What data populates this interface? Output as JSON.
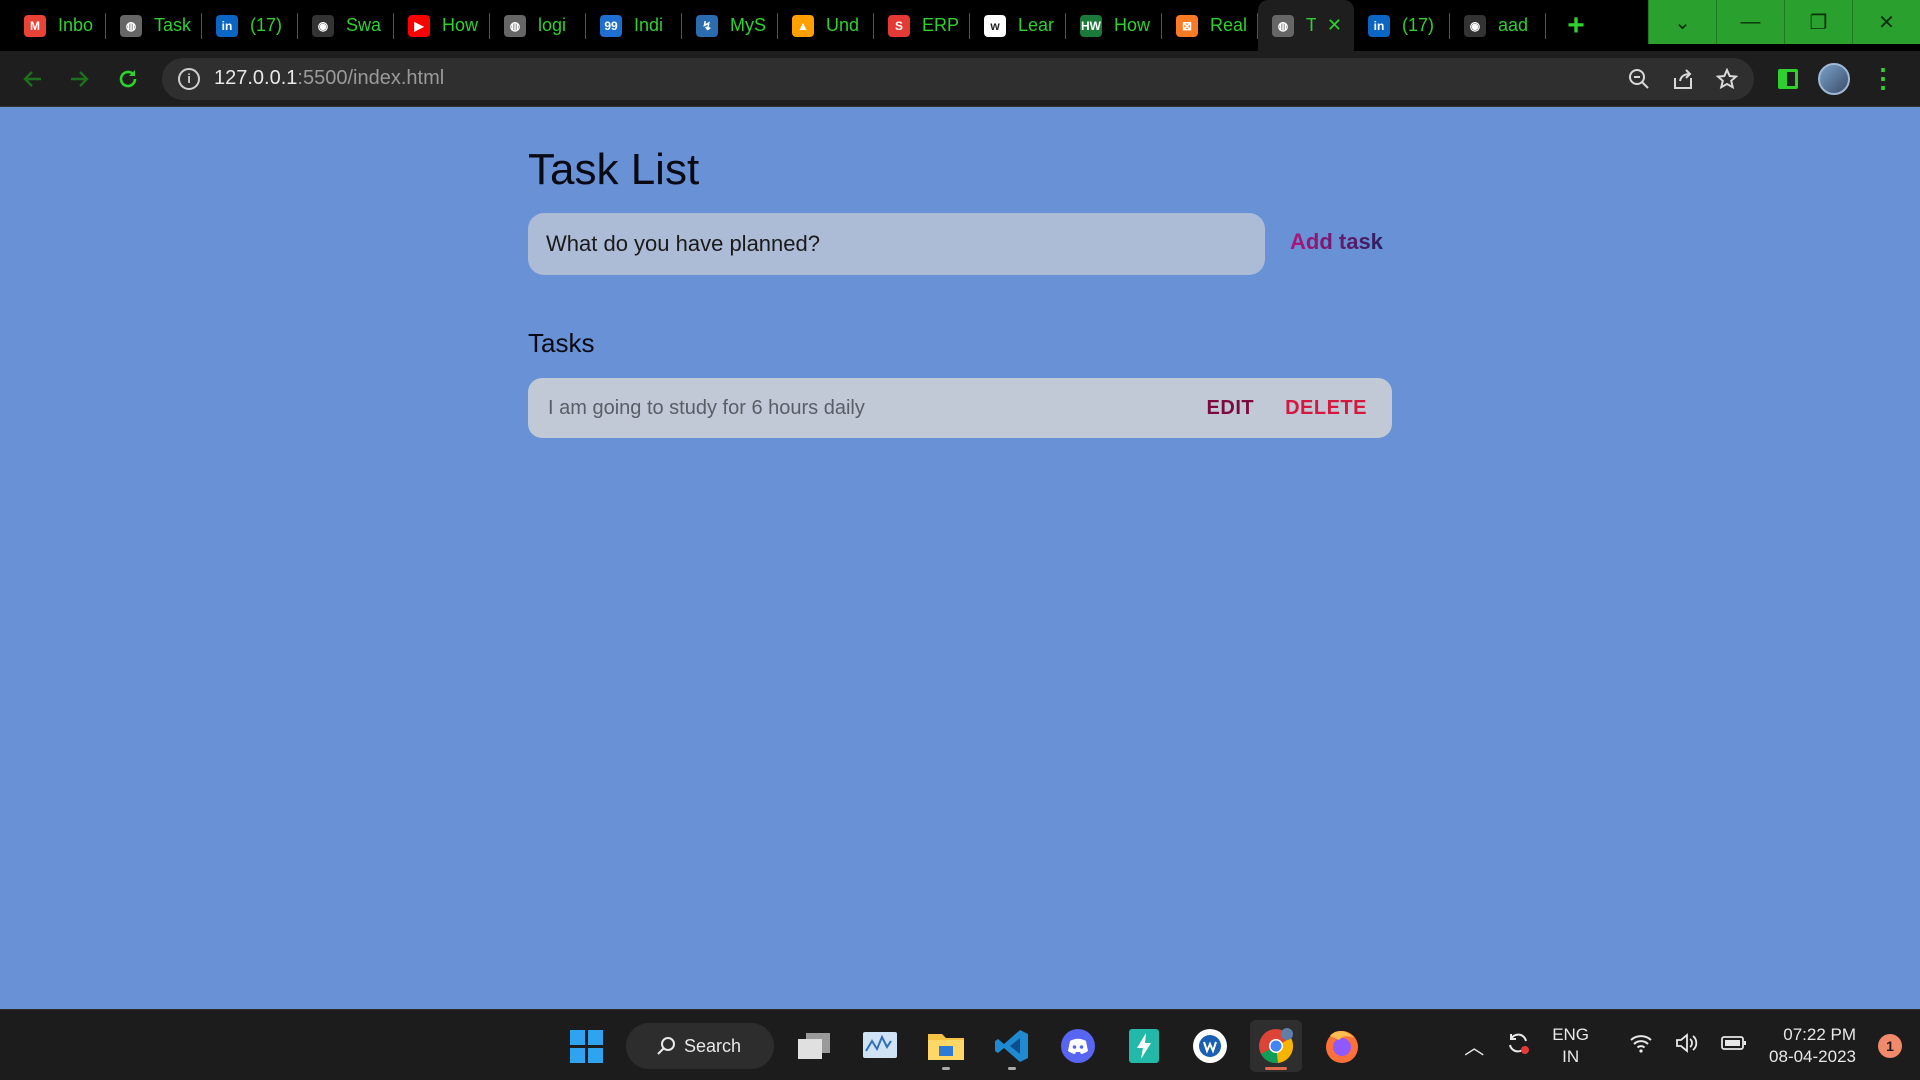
{
  "browser": {
    "tabs": [
      {
        "label": "Inbo",
        "icon": "gmail-icon",
        "fav_text": "M",
        "color": "#ea4335"
      },
      {
        "label": "Task",
        "icon": "globe-icon",
        "fav_text": "◍",
        "color": "#666666"
      },
      {
        "label": "(17)",
        "icon": "linkedin-icon",
        "fav_text": "in",
        "color": "#0a66c2"
      },
      {
        "label": "Swa",
        "icon": "github-icon",
        "fav_text": "◉",
        "color": "#333333"
      },
      {
        "label": "How",
        "icon": "youtube-icon",
        "fav_text": "▶",
        "color": "#ff0000"
      },
      {
        "label": "logi",
        "icon": "globe-icon",
        "fav_text": "◍",
        "color": "#666666"
      },
      {
        "label": "Indi",
        "icon": "99acres-icon",
        "fav_text": "99",
        "color": "#1f6fd1"
      },
      {
        "label": "MyS",
        "icon": "mysql-icon",
        "fav_text": "↯",
        "color": "#2b6cb0"
      },
      {
        "label": "Und",
        "icon": "firebase-icon",
        "fav_text": "▲",
        "color": "#ffa000"
      },
      {
        "label": "ERP",
        "icon": "erp-icon",
        "fav_text": "S",
        "color": "#e53935"
      },
      {
        "label": "Lear",
        "icon": "wipro-icon",
        "fav_text": "w",
        "color": "#ffffff"
      },
      {
        "label": "How",
        "icon": "hwa-icon",
        "fav_text": "HW",
        "color": "#1b7a3a"
      },
      {
        "label": "Real",
        "icon": "xampp-icon",
        "fav_text": "⊠",
        "color": "#fb7a24"
      },
      {
        "label": "T",
        "icon": "globe-icon",
        "fav_text": "◍",
        "color": "#666666",
        "active": true
      },
      {
        "label": "(17)",
        "icon": "linkedin-icon",
        "fav_text": "in",
        "color": "#0a66c2"
      },
      {
        "label": "aad",
        "icon": "github-icon",
        "fav_text": "◉",
        "color": "#333333"
      }
    ],
    "new_tab": "+",
    "url_host": "127.0.0.1",
    "url_rest": ":5500/index.html",
    "window_controls": {
      "dropdown": "⌄",
      "minimize": "—",
      "restore": "❐",
      "close": "✕"
    }
  },
  "app": {
    "title": "Task List",
    "input_placeholder": "What do you have planned?",
    "add_button": "Add task",
    "tasks_heading": "Tasks",
    "tasks": [
      {
        "text": "I am going to study for 6 hours daily",
        "edit": "EDIT",
        "delete": "DELETE"
      }
    ]
  },
  "taskbar": {
    "search_label": "Search",
    "lang_top": "ENG",
    "lang_bottom": "IN",
    "time": "07:22 PM",
    "date": "08-04-2023",
    "notification_count": "1"
  }
}
